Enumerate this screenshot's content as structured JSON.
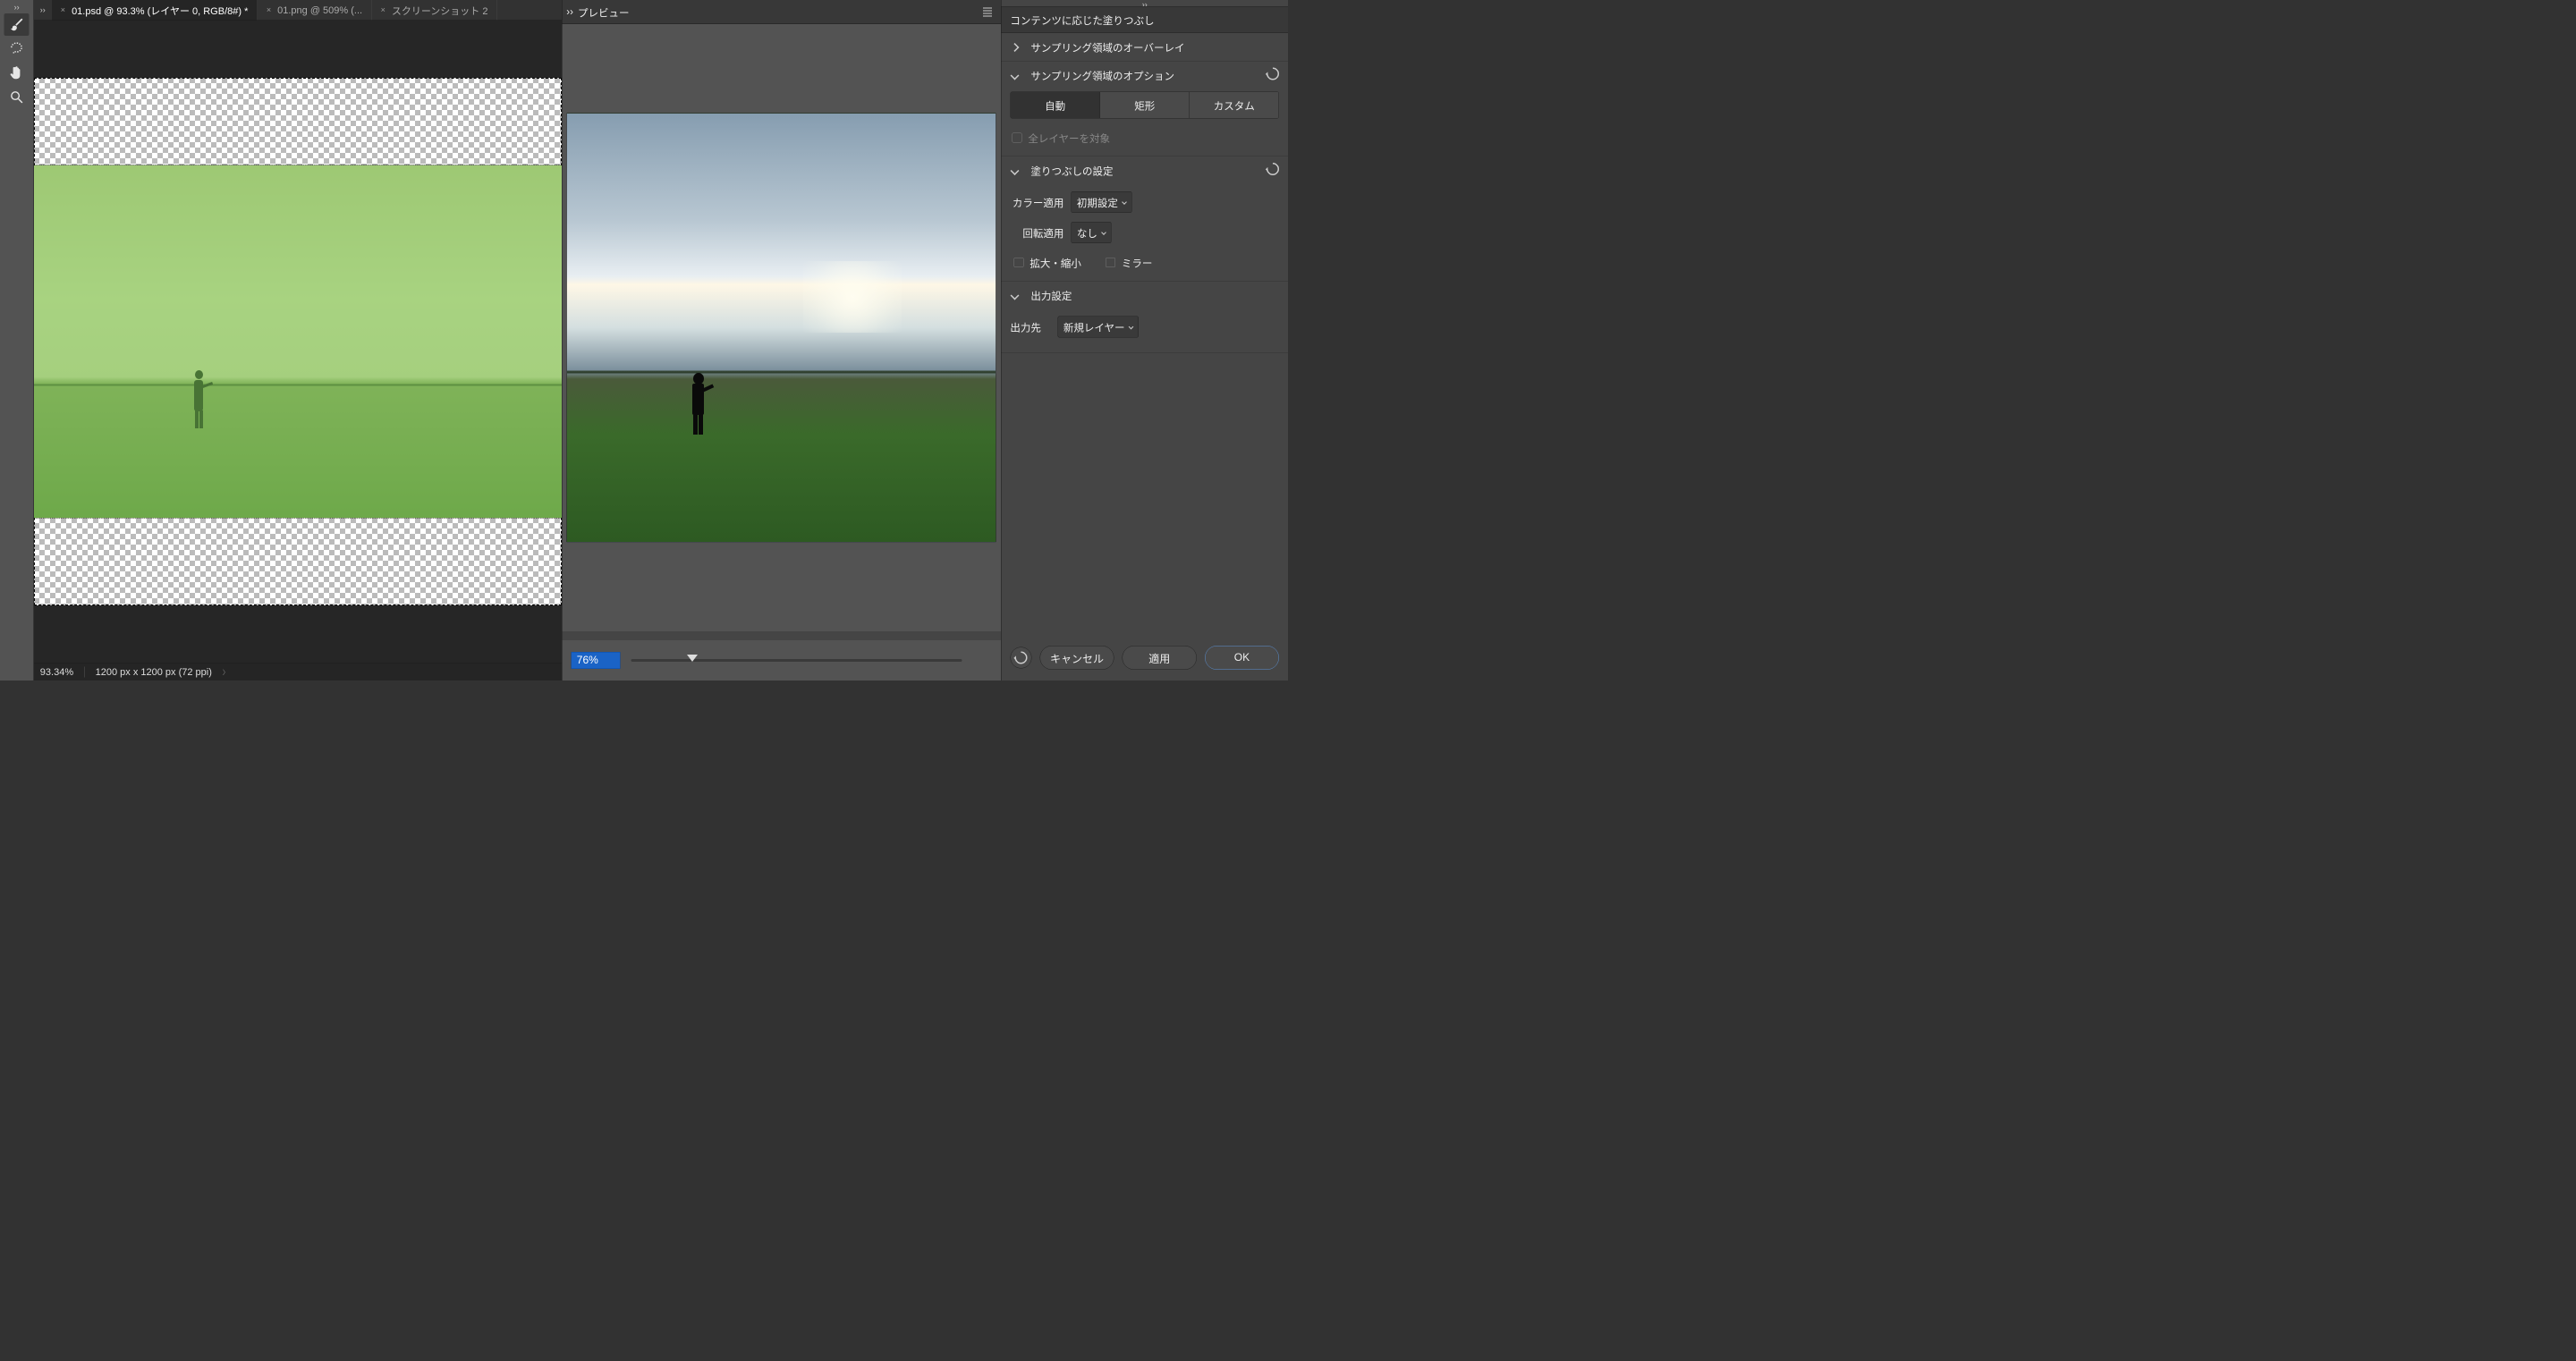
{
  "tabs": [
    {
      "label": "01.psd @ 93.3% (レイヤー 0, RGB/8#) *",
      "active": true
    },
    {
      "label": "01.png @ 509% (...",
      "active": false
    },
    {
      "label": "スクリーンショット 2",
      "active": false
    }
  ],
  "tools": [
    {
      "name": "brush-tool",
      "active": true
    },
    {
      "name": "lasso-tool",
      "active": false
    },
    {
      "name": "hand-tool",
      "active": false
    },
    {
      "name": "zoom-tool",
      "active": false
    }
  ],
  "status": {
    "zoom": "93.34%",
    "dims": "1200 px x 1200 px (72 ppi)"
  },
  "preview": {
    "title": "プレビュー",
    "zoom_value": "76%"
  },
  "sidebar": {
    "title": "コンテンツに応じた塗りつぶし",
    "section_overlay": "サンプリング領域のオーバーレイ",
    "section_options": {
      "title": "サンプリング領域のオプション",
      "seg": [
        "自動",
        "矩形",
        "カスタム"
      ],
      "all_layers": "全レイヤーを対象"
    },
    "section_fill": {
      "title": "塗りつぶしの設定",
      "color_label": "カラー適用",
      "color_value": "初期設定",
      "rotation_label": "回転適用",
      "rotation_value": "なし",
      "scale": "拡大・縮小",
      "mirror": "ミラー"
    },
    "section_output": {
      "title": "出力設定",
      "dest_label": "出力先",
      "dest_value": "新規レイヤー"
    },
    "buttons": {
      "cancel": "キャンセル",
      "apply": "適用",
      "ok": "OK"
    }
  }
}
